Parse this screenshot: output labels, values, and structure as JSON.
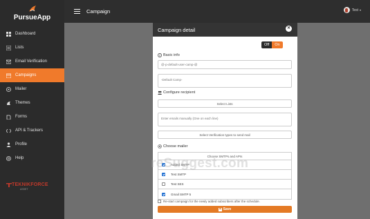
{
  "app": {
    "name": "PursueApp"
  },
  "sidebar": {
    "items": [
      {
        "label": "Dashboard",
        "icon": "dashboard-icon"
      },
      {
        "label": "Lists",
        "icon": "list-icon"
      },
      {
        "label": "Email Verification",
        "icon": "email-verify-icon"
      },
      {
        "label": "Campaigns",
        "icon": "campaign-icon",
        "active": true
      },
      {
        "label": "Mailer",
        "icon": "mailer-icon"
      },
      {
        "label": "Themes",
        "icon": "themes-icon"
      },
      {
        "label": "Forms",
        "icon": "forms-icon"
      },
      {
        "label": "API & Trackers",
        "icon": "api-icon"
      },
      {
        "label": "Profile",
        "icon": "profile-icon"
      },
      {
        "label": "Help",
        "icon": "help-icon"
      }
    ],
    "brand": {
      "name": "TEKNIKFORCE",
      "sub": "ASSET"
    }
  },
  "topbar": {
    "title": "Campaign",
    "user": "Test"
  },
  "modal": {
    "title": "Campaign detail",
    "toggle": {
      "off": "Off",
      "on": "On"
    },
    "basic_info_label": "Basic info",
    "campaign_name_value": "@-p-default-user-camp-@",
    "description_placeholder": "-Default Camp-",
    "configure_label": "Configure recipient",
    "select_lists_label": "Select Lists",
    "emails_placeholder": "Enter emails manually (One on each line)",
    "verification_label": "Select Verification types to send mail",
    "choose_mailer_label": "Choose mailer",
    "smtp_header": "Choose SMTPs and APIs",
    "smtps": [
      {
        "name": "Added SMTP",
        "checked": true
      },
      {
        "name": "Test SMTP",
        "checked": true
      },
      {
        "name": "Test SES",
        "checked": false
      },
      {
        "name": "Gmail SMTP 5",
        "checked": true
      }
    ],
    "restart_label": "Re-start campaign for the newly added subscribers after the schedule.",
    "save_label": "Save"
  },
  "watermark": "reSuggest.com",
  "colors": {
    "accent": "#f07a2b",
    "sidebar_bg": "#2b2b2b",
    "topbar_bg": "#2e2e2e",
    "brand_red": "#c0392b"
  }
}
